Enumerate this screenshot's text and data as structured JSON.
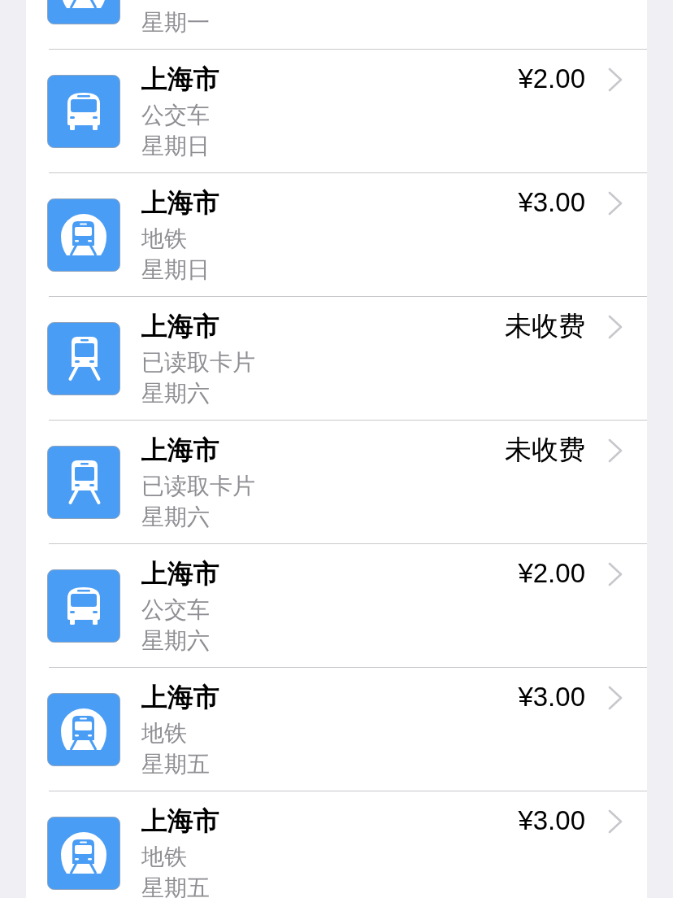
{
  "transactions": [
    {
      "kind": "metro",
      "day": "星期一"
    },
    {
      "kind": "bus",
      "city": "上海市",
      "type": "公交车",
      "day": "星期日",
      "amount": "¥2.00"
    },
    {
      "kind": "metro",
      "city": "上海市",
      "type": "地铁",
      "day": "星期日",
      "amount": "¥3.00"
    },
    {
      "kind": "train",
      "city": "上海市",
      "type": "已读取卡片",
      "day": "星期六",
      "amount": "未收费"
    },
    {
      "kind": "train",
      "city": "上海市",
      "type": "已读取卡片",
      "day": "星期六",
      "amount": "未收费"
    },
    {
      "kind": "bus",
      "city": "上海市",
      "type": "公交车",
      "day": "星期六",
      "amount": "¥2.00"
    },
    {
      "kind": "metro",
      "city": "上海市",
      "type": "地铁",
      "day": "星期五",
      "amount": "¥3.00"
    },
    {
      "kind": "metro",
      "city": "上海市",
      "type": "地铁",
      "day": "星期五",
      "amount": "¥3.00"
    }
  ]
}
